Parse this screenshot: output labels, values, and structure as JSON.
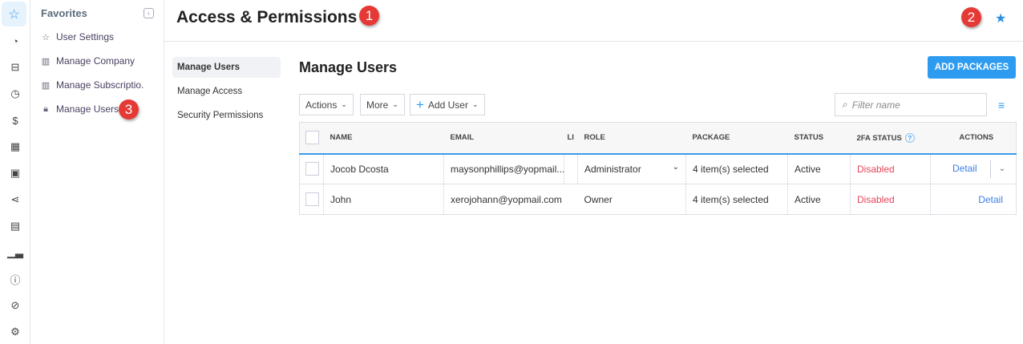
{
  "rail": {
    "icons": [
      "star-icon",
      "dashboard-icon",
      "briefcase-icon",
      "time-money-icon",
      "invoice-icon",
      "calculator-icon",
      "contact-icon",
      "share-icon",
      "id-card-icon",
      "analytics-icon",
      "help-icon",
      "link-icon",
      "settings-icon"
    ]
  },
  "favorites": {
    "title": "Favorites",
    "items": [
      {
        "label": "User Settings",
        "icon": "star-icon"
      },
      {
        "label": "Manage Company",
        "icon": "building-icon"
      },
      {
        "label": "Manage Subscriptio.",
        "icon": "building-icon"
      },
      {
        "label": "Manage Users",
        "icon": "lock-icon"
      }
    ]
  },
  "header": {
    "title": "Access & Permissions"
  },
  "annotations": [
    "1",
    "2",
    "3"
  ],
  "subnav": [
    "Manage Users",
    "Manage Access",
    "Security Permissions"
  ],
  "content": {
    "title": "Manage Users",
    "add_packages": "ADD PACKAGES",
    "actions": "Actions",
    "more": "More",
    "add_user": "Add User",
    "filter_placeholder": "Filter name"
  },
  "table": {
    "headers": [
      "NAME",
      "EMAIL",
      "LI",
      "ROLE",
      "PACKAGE",
      "STATUS",
      "2FA STATUS",
      "ACTIONS"
    ],
    "rows": [
      {
        "name": "Jocob Dcosta",
        "email": "maysonphillips@yopmail....",
        "role": "Administrator",
        "package": "4 item(s) selected",
        "status": "Active",
        "tfa": "Disabled",
        "action": "Detail"
      },
      {
        "name": "John",
        "email": "xerojohann@yopmail.com",
        "role": "Owner",
        "package": "4 item(s) selected",
        "status": "Active",
        "tfa": "Disabled",
        "action": "Detail"
      }
    ]
  },
  "colors": {
    "accent": "#2d9cf0",
    "danger": "#e8435a",
    "badge": "#e53935"
  }
}
